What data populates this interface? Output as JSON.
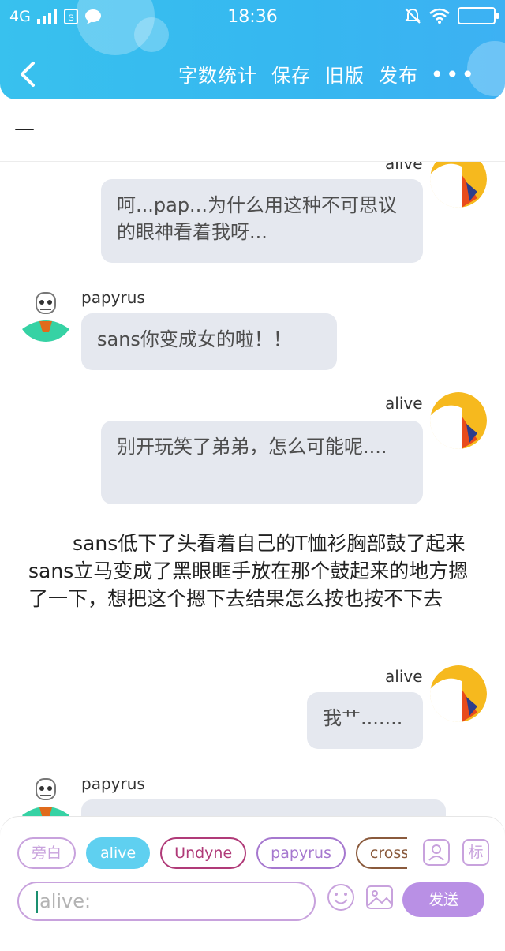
{
  "status_bar": {
    "network": "4G",
    "time": "18:36",
    "icons": [
      "signal-icon",
      "sim-icon",
      "chat-notification-icon",
      "mute-icon",
      "wifi-icon",
      "battery-icon"
    ]
  },
  "nav": {
    "back_icon": "chevron-left-icon",
    "word_count": "字数统计",
    "save": "保存",
    "old_version": "旧版",
    "publish": "发布",
    "more": "•••"
  },
  "title": "—",
  "messages": [
    {
      "type": "right",
      "name": "alive",
      "text": "呵...pap...为什么用这种不可思议的眼神看着我呀..."
    },
    {
      "type": "left",
      "name": "papyrus",
      "text": "sans你变成女的啦！！"
    },
    {
      "type": "right",
      "name": "alive",
      "text": "别开玩笑了弟弟，怎么可能呢...."
    },
    {
      "type": "narration",
      "text": "sans低下了头看着自己的T恤衫胸部鼓了起来sans立马变成了黑眼眶手放在那个鼓起来的地方摁了一下，想把这个摁下去结果怎么按也按不下去"
    },
    {
      "type": "right",
      "name": "alive",
      "text": "我艹......."
    },
    {
      "type": "left",
      "name": "papyrus",
      "text": ""
    }
  ],
  "input_panel": {
    "roles": [
      {
        "label": "旁白",
        "color": "#c8a2dd",
        "active": false
      },
      {
        "label": "alive",
        "color": "#5fd0f0",
        "active": true
      },
      {
        "label": "Undyne",
        "color": "#b03a78",
        "active": false
      },
      {
        "label": "papyrus",
        "color": "#a678cf",
        "active": false
      },
      {
        "label": "cross",
        "color": "#8a5a3c",
        "active": false
      }
    ],
    "role_icon_label": "标",
    "placeholder": "alive:",
    "send": "发送",
    "accent": "#b990e5"
  }
}
